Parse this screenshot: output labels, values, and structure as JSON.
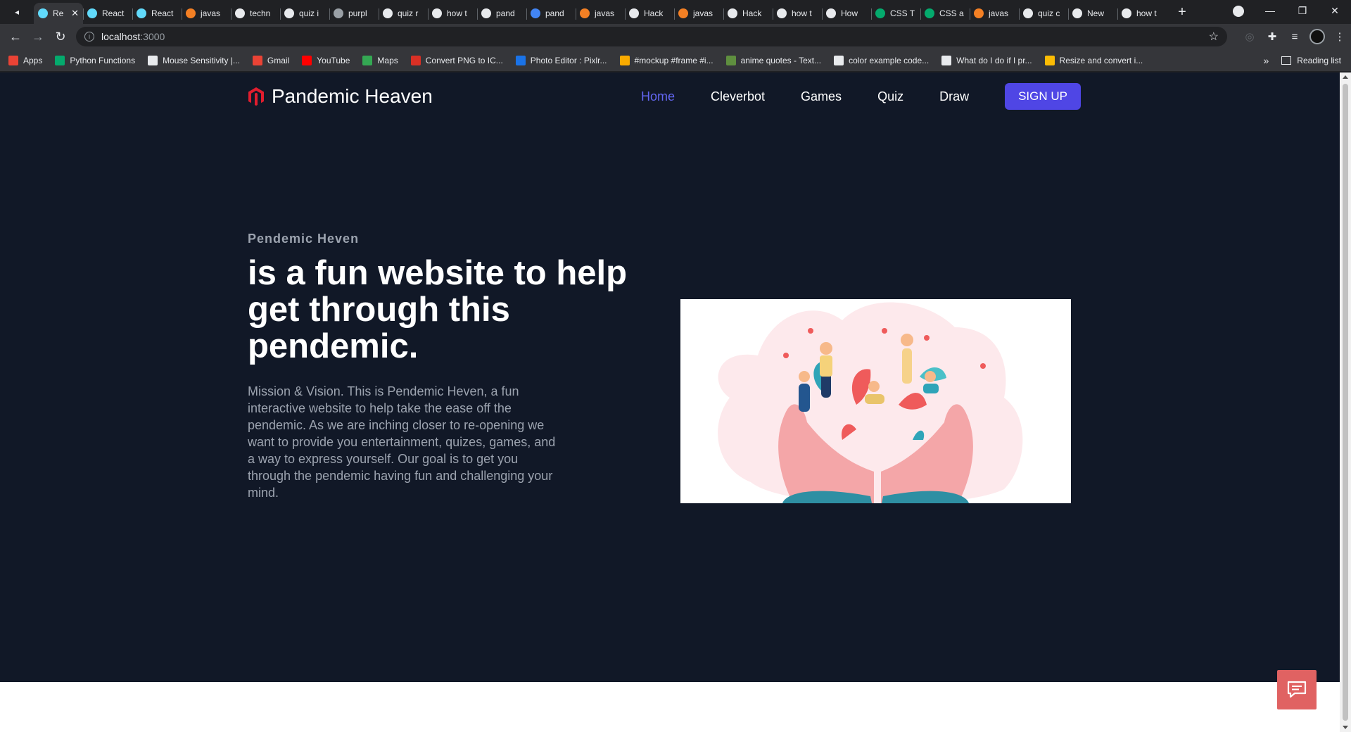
{
  "browser": {
    "tabs": [
      {
        "label": "Re",
        "active": true,
        "favicon_color": "#61dafb"
      },
      {
        "label": "React",
        "favicon_color": "#61dafb"
      },
      {
        "label": "React",
        "favicon_color": "#61dafb"
      },
      {
        "label": "javas",
        "favicon_color": "#f48024"
      },
      {
        "label": "techn",
        "favicon_color": "#e8eaed"
      },
      {
        "label": "quiz i",
        "favicon_color": "#e8eaed"
      },
      {
        "label": "purpl",
        "favicon_color": "#9aa0a6"
      },
      {
        "label": "quiz r",
        "favicon_color": "#e8eaed"
      },
      {
        "label": "how t",
        "favicon_color": "#e8eaed"
      },
      {
        "label": "pand",
        "favicon_color": "#e8eaed"
      },
      {
        "label": "pand",
        "favicon_color": "#4285f4"
      },
      {
        "label": "javas",
        "favicon_color": "#f48024"
      },
      {
        "label": "Hack",
        "favicon_color": "#e8eaed"
      },
      {
        "label": "javas",
        "favicon_color": "#f48024"
      },
      {
        "label": "Hack",
        "favicon_color": "#e8eaed"
      },
      {
        "label": "how t",
        "favicon_color": "#e8eaed"
      },
      {
        "label": "How",
        "favicon_color": "#e8eaed"
      },
      {
        "label": "CSS T",
        "favicon_color": "#04aa6d"
      },
      {
        "label": "CSS a",
        "favicon_color": "#04aa6d"
      },
      {
        "label": "javas",
        "favicon_color": "#f48024"
      },
      {
        "label": "quiz c",
        "favicon_color": "#e8eaed"
      },
      {
        "label": "New",
        "favicon_color": "#e8eaed"
      },
      {
        "label": "how t",
        "favicon_color": "#e8eaed"
      }
    ],
    "url_host": "localhost",
    "url_port": ":3000",
    "bookmarks": [
      {
        "label": "Apps",
        "color": "#ea4335"
      },
      {
        "label": "Python Functions",
        "color": "#04aa6d"
      },
      {
        "label": "Mouse Sensitivity |...",
        "color": "#e8eaed"
      },
      {
        "label": "Gmail",
        "color": "#ea4335"
      },
      {
        "label": "YouTube",
        "color": "#ff0000"
      },
      {
        "label": "Maps",
        "color": "#34a853"
      },
      {
        "label": "Convert PNG to IC...",
        "color": "#d93025"
      },
      {
        "label": "Photo Editor : Pixlr...",
        "color": "#1a73e8"
      },
      {
        "label": "#mockup #frame #i...",
        "color": "#f9ab00"
      },
      {
        "label": "anime quotes - Text...",
        "color": "#5f8f3f"
      },
      {
        "label": "color example code...",
        "color": "#e8eaed"
      },
      {
        "label": "What do I do if I pr...",
        "color": "#e8eaed"
      },
      {
        "label": "Resize and convert i...",
        "color": "#fbbc04"
      }
    ],
    "reading_list_label": "Reading list"
  },
  "site": {
    "logo_text": "Pandemic Heaven",
    "brand_color": "#e11d2e",
    "nav": {
      "home": "Home",
      "cleverbot": "Cleverbot",
      "games": "Games",
      "quiz": "Quiz",
      "draw": "Draw",
      "signup": "SIGN UP"
    },
    "hero": {
      "kicker": "Pendemic Heven",
      "headline": "is a fun website to help get through this pendemic.",
      "body": "Mission & Vision. This is Pendemic Heven, a fun interactive website to help take the ease off the pendemic. As we are inching closer to re-opening we want to provide you entertainment, quizes, games, and a way to express yourself. Our goal is to get you through the pendemic having fun and challenging your mind."
    },
    "accent_color": "#4f46e5",
    "background_color": "#111827"
  }
}
